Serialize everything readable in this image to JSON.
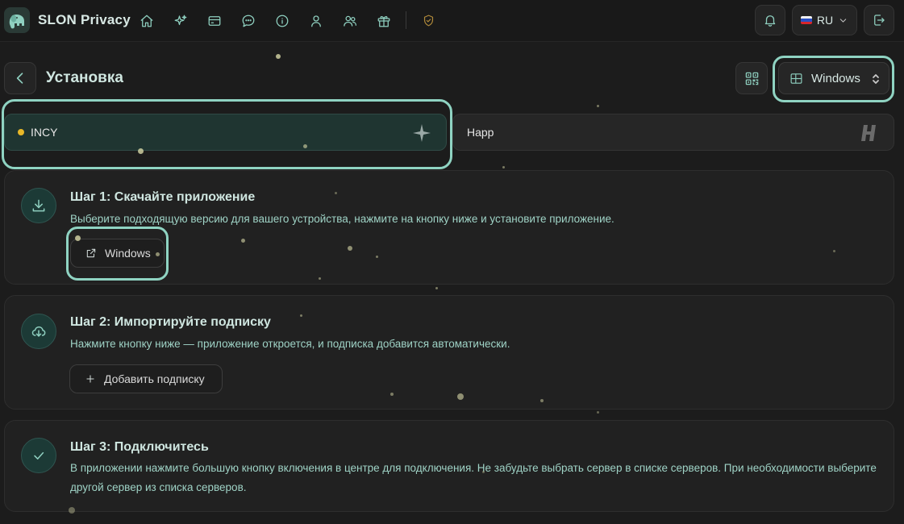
{
  "header": {
    "brand": "SLON Privacy",
    "nav_icons": [
      "home-icon",
      "sparkles-icon",
      "card-icon",
      "chat-icon",
      "info-icon",
      "user-icon",
      "users-icon",
      "gift-icon"
    ],
    "status_icon": "shield-check-icon",
    "language": "RU",
    "colors": {
      "accent": "#8fd0c0",
      "background": "#1c1c1c"
    }
  },
  "page": {
    "title": "Установка",
    "os_select": {
      "value": "Windows"
    }
  },
  "apps": [
    {
      "name": "INCY",
      "active": true,
      "status_color": "#e8b828"
    },
    {
      "name": "Happ",
      "active": false
    }
  ],
  "steps": [
    {
      "title": "Шаг 1: Скачайте приложение",
      "description": "Выберите подходящую версию для вашего устройства, нажмите на кнопку ниже и установите приложение.",
      "button": "Windows",
      "icon": "download-icon"
    },
    {
      "title": "Шаг 2: Импортируйте подписку",
      "description": "Нажмите кнопку ниже — приложение откроется, и подписка добавится автоматически.",
      "button": "Добавить подписку",
      "icon": "cloud-download-icon"
    },
    {
      "title": "Шаг 3: Подключитесь",
      "description": "В приложении нажмите большую кнопку включения в центре для подключения. Не забудьте выбрать сервер в списке серверов. При необходимости выберите другой сервер из списка серверов.",
      "icon": "check-icon"
    }
  ]
}
